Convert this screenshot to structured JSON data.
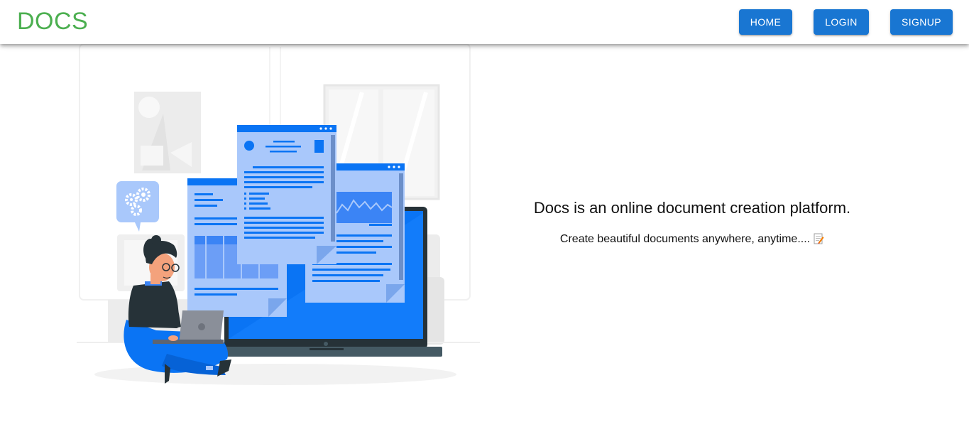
{
  "header": {
    "brand": "DOCS",
    "nav": {
      "home": "HOME",
      "login": "LOGIN",
      "signup": "SIGNUP"
    }
  },
  "hero": {
    "illustration": "person-with-laptop-and-documents-illustration",
    "tagline": "Docs is an online document creation platform.",
    "subtitle": "Create beautiful documents anywhere, anytime....",
    "subtitle_icon": "memo-icon"
  },
  "colors": {
    "brand": "#4caf50",
    "primary": "#1976d2",
    "illustration_blue": "#0a74f4",
    "illustration_light_blue": "#a9c8fb"
  }
}
